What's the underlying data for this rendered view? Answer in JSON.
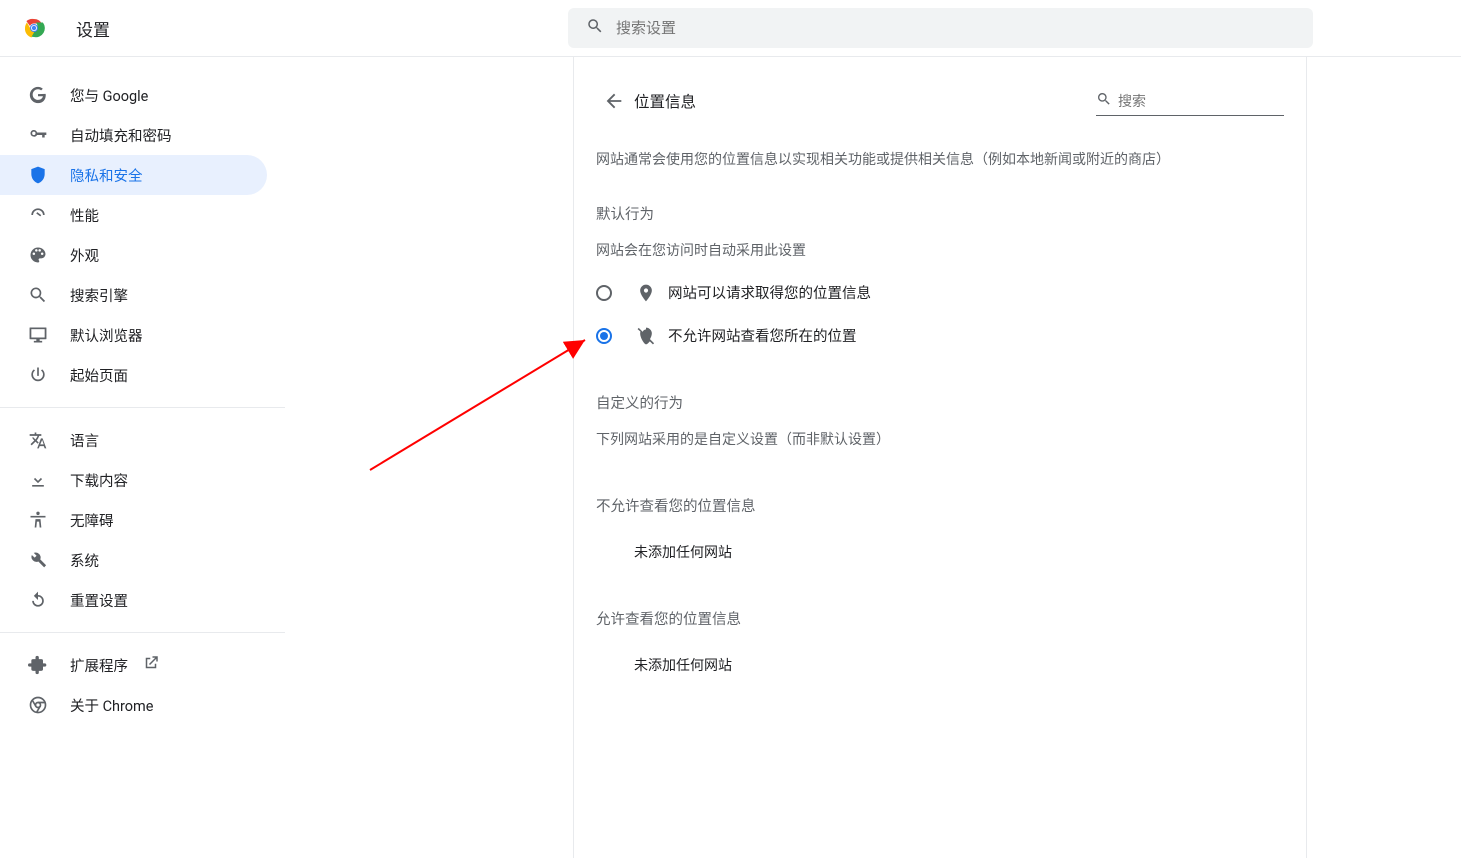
{
  "toolbar": {
    "title": "设置",
    "search_placeholder": "搜索设置"
  },
  "sidebar": {
    "group1": [
      {
        "id": "you-google",
        "label": "您与 Google",
        "icon": "google"
      },
      {
        "id": "autofill",
        "label": "自动填充和密码",
        "icon": "key"
      },
      {
        "id": "privacy",
        "label": "隐私和安全",
        "icon": "shield",
        "selected": true
      },
      {
        "id": "performance",
        "label": "性能",
        "icon": "gauge"
      },
      {
        "id": "appearance",
        "label": "外观",
        "icon": "palette"
      },
      {
        "id": "search-engine",
        "label": "搜索引擎",
        "icon": "search"
      },
      {
        "id": "default-browser",
        "label": "默认浏览器",
        "icon": "monitor"
      },
      {
        "id": "startup",
        "label": "起始页面",
        "icon": "power"
      }
    ],
    "group2": [
      {
        "id": "language",
        "label": "语言",
        "icon": "translate"
      },
      {
        "id": "downloads",
        "label": "下载内容",
        "icon": "download"
      },
      {
        "id": "a11y",
        "label": "无障碍",
        "icon": "a11y"
      },
      {
        "id": "system",
        "label": "系统",
        "icon": "wrench"
      },
      {
        "id": "reset",
        "label": "重置设置",
        "icon": "reset"
      }
    ],
    "group3": [
      {
        "id": "extensions",
        "label": "扩展程序",
        "icon": "extension",
        "external": true
      },
      {
        "id": "about",
        "label": "关于 Chrome",
        "icon": "chrome"
      }
    ]
  },
  "main": {
    "page_title": "位置信息",
    "search_placeholder": "搜索",
    "intro": "网站通常会使用您的位置信息以实现相关功能或提供相关信息（例如本地新闻或附近的商店）",
    "default_section": {
      "title": "默认行为",
      "subtitle": "网站会在您访问时自动采用此设置",
      "options": [
        {
          "id": "ask",
          "label": "网站可以请求取得您的位置信息",
          "icon": "location",
          "selected": false
        },
        {
          "id": "block",
          "label": "不允许网站查看您所在的位置",
          "icon": "location-off",
          "selected": true
        }
      ]
    },
    "custom_section": {
      "title": "自定义的行为",
      "subtitle": "下列网站采用的是自定义设置（而非默认设置）",
      "blocked_title": "不允许查看您的位置信息",
      "blocked_empty": "未添加任何网站",
      "allowed_title": "允许查看您的位置信息",
      "allowed_empty": "未添加任何网站"
    }
  }
}
